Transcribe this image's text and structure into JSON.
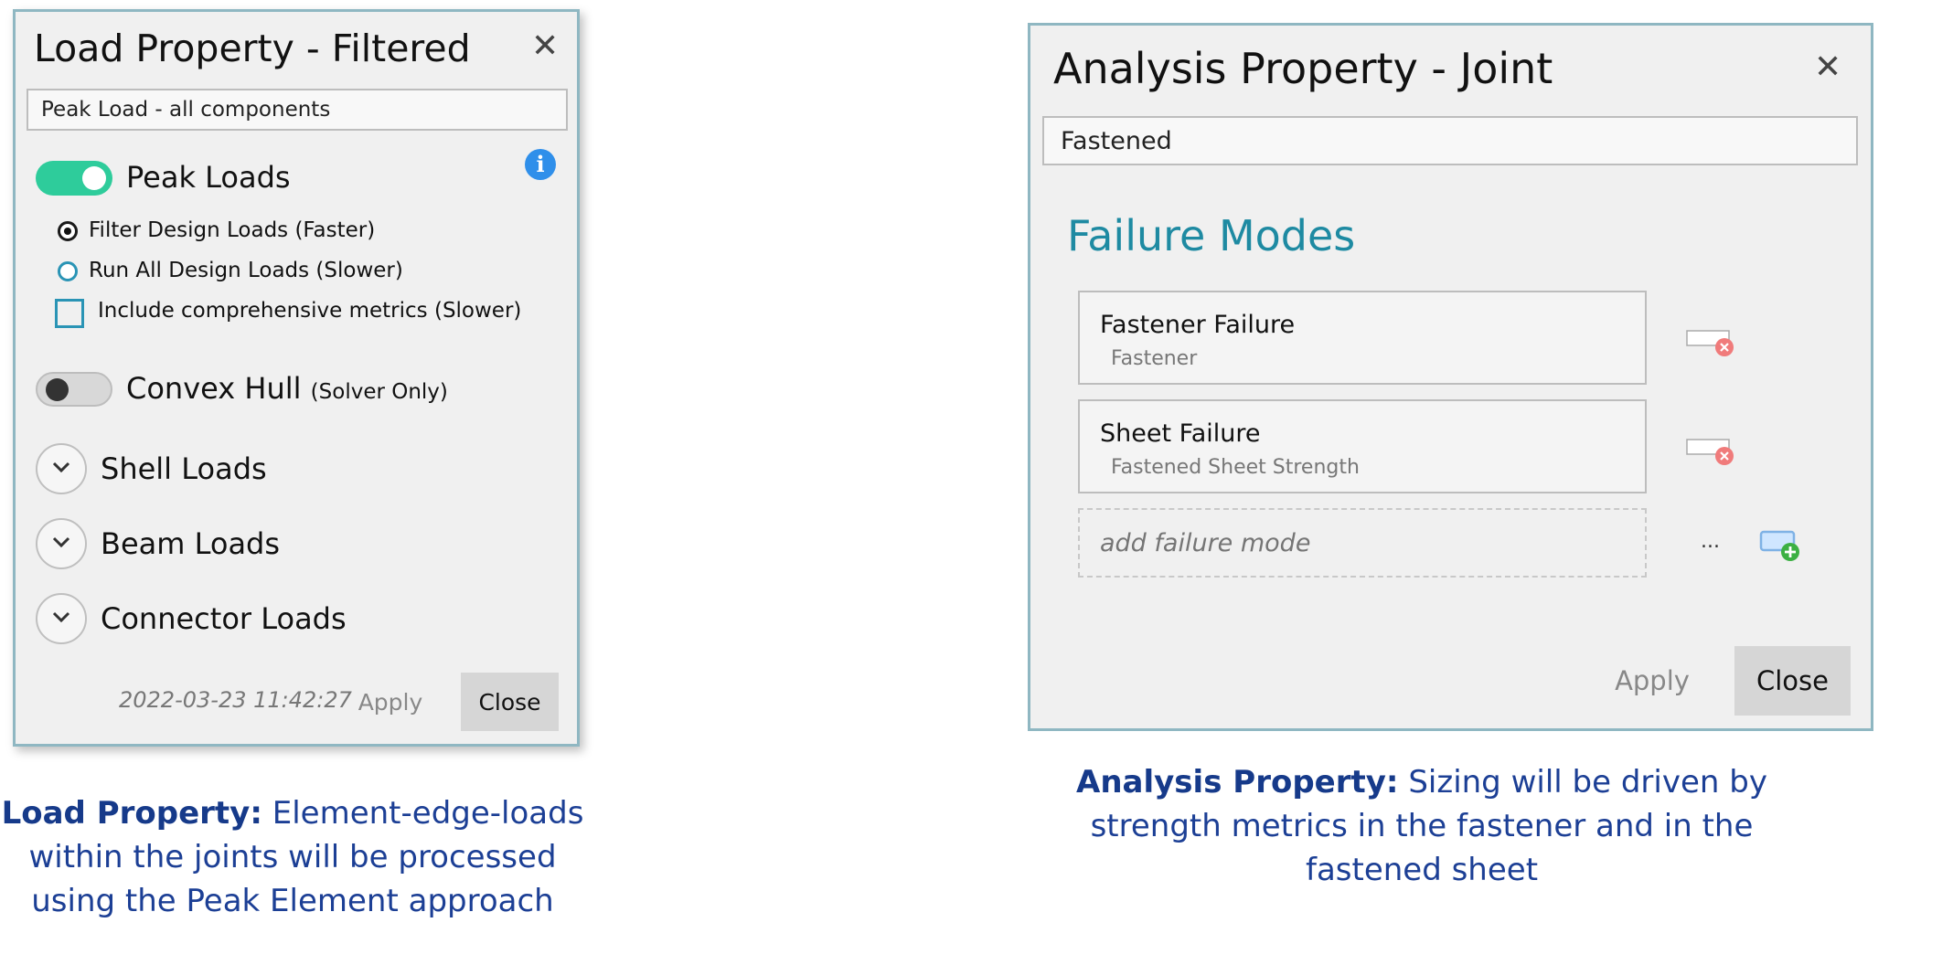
{
  "load_property": {
    "title": "Load Property - Filtered",
    "name_value": "Peak Load - all components",
    "peak_loads": {
      "label": "Peak Loads",
      "enabled": true
    },
    "options": [
      {
        "label": "Filter Design Loads (Faster)",
        "selected": true
      },
      {
        "label": "Run All Design Loads (Slower)",
        "selected": false
      }
    ],
    "checkbox_label": "Include comprehensive metrics (Slower)",
    "convex_hull": {
      "label": "Convex Hull",
      "note": "(Solver Only)",
      "enabled": false
    },
    "sections": [
      "Shell Loads",
      "Beam Loads",
      "Connector Loads"
    ],
    "timestamp": "2022-03-23 11:42:27",
    "apply_label": "Apply",
    "close_label": "Close"
  },
  "analysis_property": {
    "title": "Analysis Property - Joint",
    "name_value": "Fastened",
    "section_title": "Failure Modes",
    "failure_modes": [
      {
        "name": "Fastener Failure",
        "detail": "Fastener"
      },
      {
        "name": "Sheet Failure",
        "detail": "Fastened Sheet Strength"
      }
    ],
    "add_placeholder": "add failure mode",
    "ellipsis": "...",
    "apply_label": "Apply",
    "close_label": "Close"
  },
  "captions": {
    "load": {
      "bold": "Load Property:",
      "text": "Element-edge-loads within the joints will be processed using the Peak Element approach"
    },
    "analysis": {
      "bold": "Analysis Property:",
      "text": "Sizing will be driven by strength metrics in the fastener and in the fastened sheet"
    }
  },
  "colors": {
    "toggle_on": "#2ecc9b",
    "accent_heading": "#1e8aa2",
    "caption_text": "#1c3f95",
    "info_icon": "#2f8fea",
    "remove_icon": "#f07b7b",
    "add_icon": "#3cb043"
  },
  "icons": {
    "close": "close-icon",
    "info": "info-icon",
    "expand": "chevron-down-icon",
    "remove": "remove-failure-mode-icon",
    "add": "add-failure-mode-icon"
  }
}
